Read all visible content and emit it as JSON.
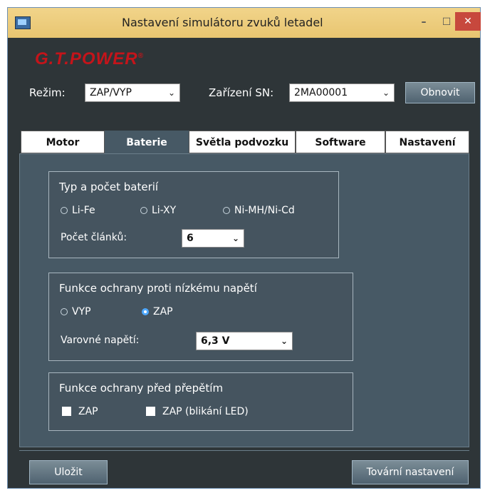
{
  "window": {
    "title": "Nastavení simulátoru zvuků letadel",
    "minimize": "–",
    "maximize": "☐",
    "close": "✕"
  },
  "logo": "G.T.POWER",
  "logo_mark": "®",
  "controls": {
    "mode_label": "Režim:",
    "mode_value": "ZAP/VYP",
    "device_label": "Zařízení SN:",
    "device_value": "2MA00001",
    "refresh_button": "Obnovit"
  },
  "tabs": [
    {
      "label": "Motor",
      "active": false
    },
    {
      "label": "Baterie",
      "active": true
    },
    {
      "label": "Světla podvozku",
      "active": false
    },
    {
      "label": "Software",
      "active": false
    },
    {
      "label": "Nastavení",
      "active": false
    }
  ],
  "battery": {
    "title": "Typ a počet baterií",
    "types": [
      "Li-Fe",
      "Li-XY",
      "Ni-MH/Ni-Cd"
    ],
    "cell_count_label": "Počet článků:",
    "cell_count_value": "6"
  },
  "low_voltage": {
    "title": "Funkce ochrany proti nízkému napětí",
    "off_label": "VYP",
    "on_label": "ZAP",
    "selected": "ZAP",
    "warning_label": "Varovné napětí:",
    "warning_value": "6,3 V"
  },
  "overvoltage": {
    "title": "Funkce ochrany před přepětím",
    "option1": "ZAP",
    "option2": "ZAP (blikání LED)"
  },
  "footer": {
    "save_button": "Uložit",
    "factory_button": "Tovární nastavení"
  },
  "icons": {
    "dropdown": "⌄"
  }
}
